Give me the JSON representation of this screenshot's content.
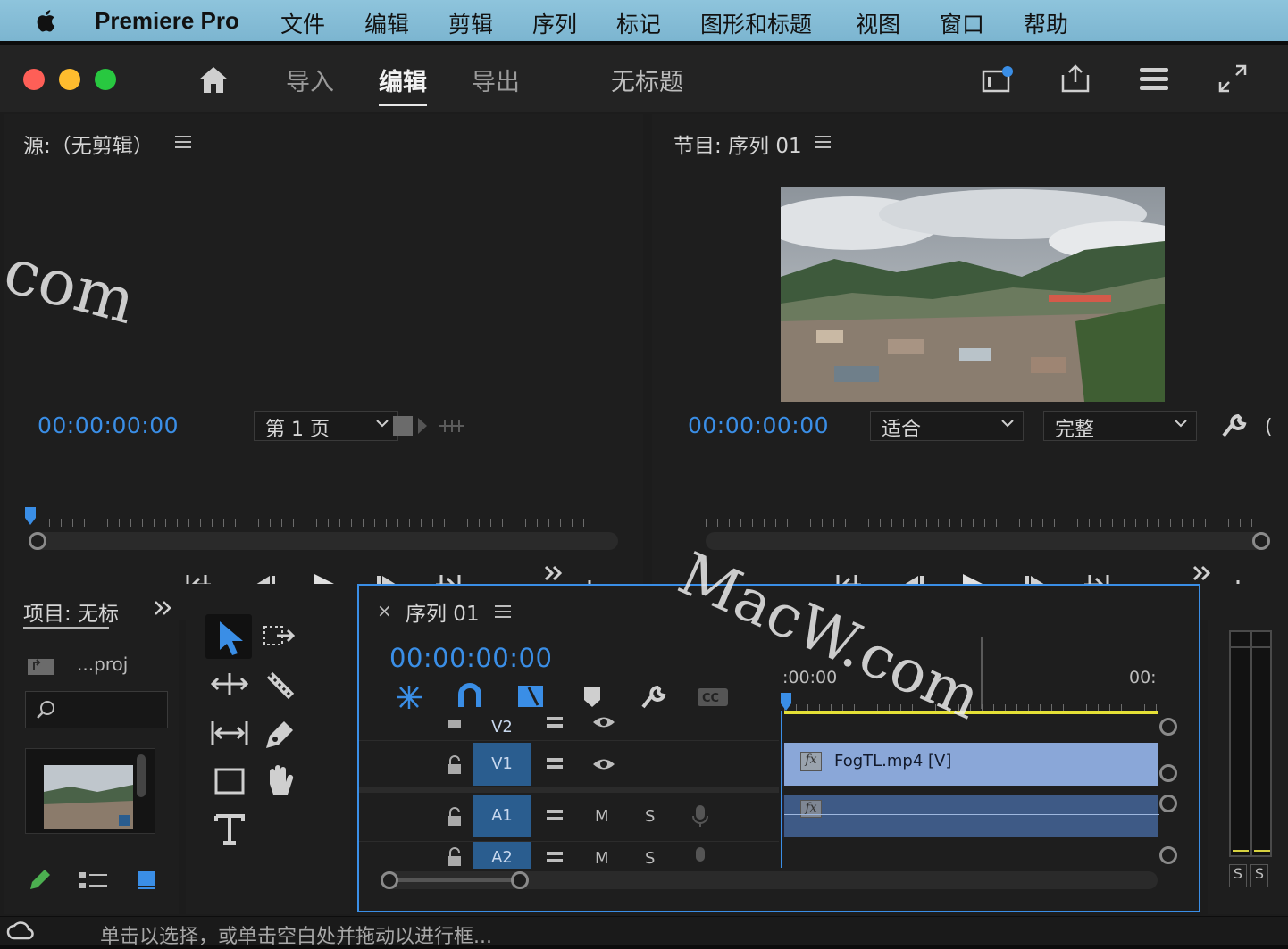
{
  "menubar": {
    "app": "Premiere Pro",
    "items": [
      "文件",
      "编辑",
      "剪辑",
      "序列",
      "标记",
      "图形和标题",
      "视图",
      "窗口",
      "帮助"
    ]
  },
  "titlebar": {
    "tabs": [
      "导入",
      "编辑",
      "导出"
    ],
    "active_tab": "编辑",
    "project_title": "无标题",
    "icons": [
      "home-icon",
      "quick-export-icon",
      "share-icon",
      "workspaces-icon",
      "fullscreen-icon"
    ]
  },
  "source_monitor": {
    "title": "源:（无剪辑）",
    "timecode": "00:00:00:00",
    "page_select": "第 1 页"
  },
  "program_monitor": {
    "title": "节目: 序列 01",
    "timecode": "00:00:00:00",
    "fit": "适合",
    "quality": "完整"
  },
  "project_panel": {
    "title": "项目: 无标",
    "file": "...proj"
  },
  "timeline": {
    "title": "序列 01",
    "timecode": "00:00:00:00",
    "ruler_start": ":00:00",
    "ruler_end": "00:",
    "tracks": {
      "v2": "V2",
      "v1": "V1",
      "a1": "A1",
      "a2": "A2",
      "mute": "M",
      "solo": "S"
    },
    "clips": {
      "video": "FogTL.mp4 [V]",
      "fx": "fx"
    }
  },
  "audio_meter": {
    "s1": "S",
    "s2": "S"
  },
  "status": {
    "hint": "单击以选择，或单击空白处并拖动以进行框..."
  },
  "watermark": {
    "text1": ".com",
    "text2": "MacW.com"
  },
  "colors": {
    "accent": "#3a8ee6",
    "track_on": "#2a5d8f",
    "clip_video": "#8aa7d8",
    "clip_audio": "#3e5a86",
    "work_bar": "#e5e036"
  }
}
